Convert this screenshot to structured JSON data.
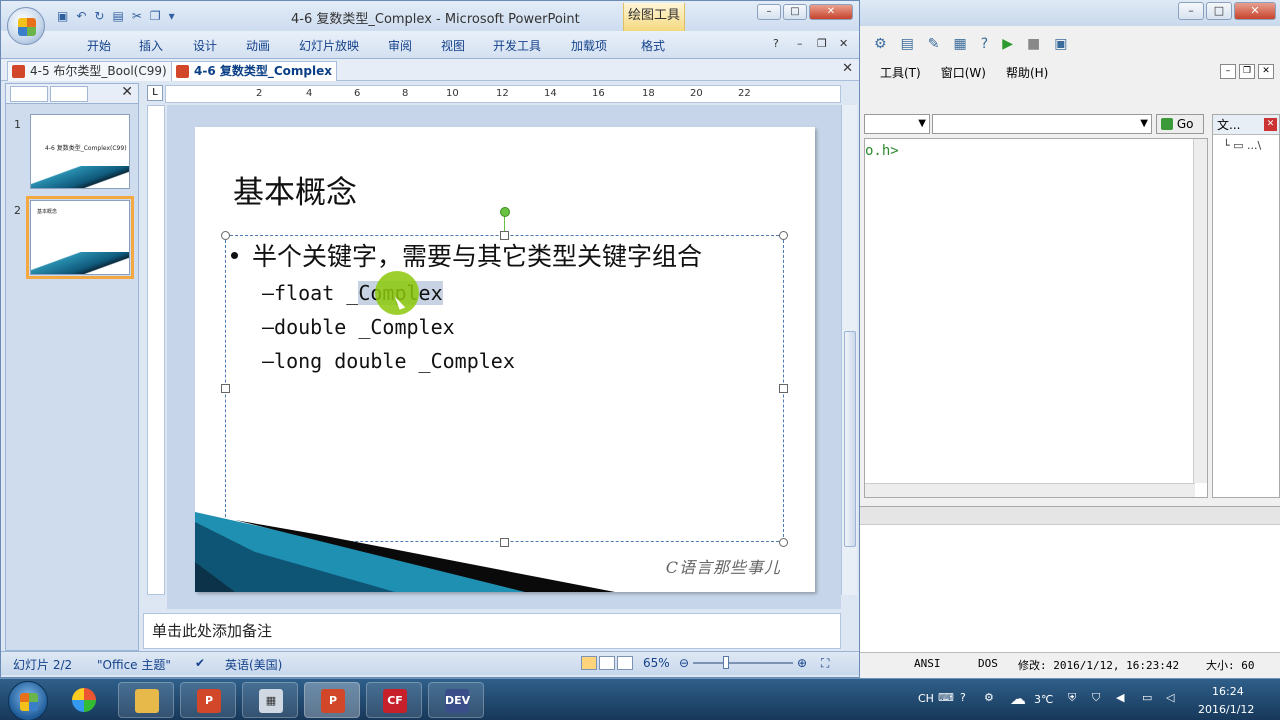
{
  "ppt": {
    "window_title": "4-6 复数类型_Complex - Microsoft PowerPoint",
    "drawing_tools": "绘图工具",
    "ribbon_tabs": [
      "开始",
      "插入",
      "设计",
      "动画",
      "幻灯片放映",
      "审阅",
      "视图",
      "开发工具",
      "加载项",
      "格式"
    ],
    "doc_tabs": [
      "4-5 布尔类型_Bool(C99)",
      "4-6 复数类型_Complex"
    ],
    "slide_thumbs": [
      {
        "num": "1",
        "title": "4-6 复数类型_Complex(C99)"
      },
      {
        "num": "2",
        "title": "基本概念"
      }
    ],
    "slide": {
      "heading": "基本概念",
      "bullet": "半个关键字，需要与其它类型关键字组合",
      "subs": [
        "–float _Complex",
        "–double _Complex",
        "–long double _Complex"
      ],
      "signature": "C语言那些事儿"
    },
    "notes_placeholder": "单击此处添加备注",
    "status": {
      "slide_count": "幻灯片 2/2",
      "theme": "\"Office 主题\"",
      "language": "英语(美国)",
      "zoom": "65%",
      "zoom_fraction": 0.65
    }
  },
  "ide": {
    "menu": [
      "工具(T)",
      "窗口(W)",
      "帮助(H)"
    ],
    "go_label": "Go",
    "code_line": "o.h>",
    "panel_title": "文...",
    "status": {
      "encoding": "ANSI",
      "lineend": "DOS",
      "modified": "修改: 2016/1/12, 16:23:42",
      "size": "大小: 60"
    }
  },
  "taskbar": {
    "ime": "CH",
    "temperature": "3℃",
    "time": "16:24",
    "date": "2016/1/12",
    "apps": [
      "explorer",
      "powerpoint",
      "calculator",
      "powerpoint-active",
      "c-free",
      "dev-cpp"
    ]
  },
  "colors": {
    "accent": "#f4a841",
    "handle_green": "#6ac340",
    "selection": "#c7d3e3"
  }
}
